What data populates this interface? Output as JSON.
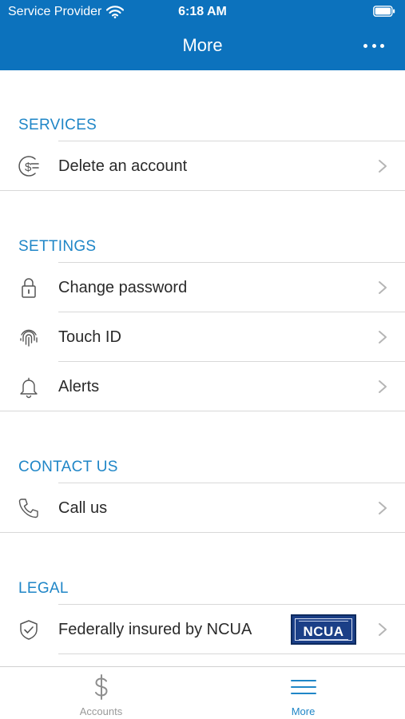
{
  "status_bar": {
    "carrier": "Service Provider",
    "time": "6:18 AM"
  },
  "header": {
    "title": "More"
  },
  "sections": {
    "services": {
      "title": "SERVICES",
      "items": [
        {
          "label": "Delete an account",
          "icon": "dollar-circle-icon"
        }
      ]
    },
    "settings": {
      "title": "SETTINGS",
      "items": [
        {
          "label": "Change password",
          "icon": "lock-icon"
        },
        {
          "label": "Touch ID",
          "icon": "fingerprint-icon"
        },
        {
          "label": "Alerts",
          "icon": "bell-icon"
        }
      ]
    },
    "contact": {
      "title": "CONTACT US",
      "items": [
        {
          "label": "Call us",
          "icon": "phone-icon"
        }
      ]
    },
    "legal": {
      "title": "LEGAL",
      "items": [
        {
          "label": "Federally insured by NCUA",
          "icon": "shield-check-icon",
          "logo_text": "NCUA"
        }
      ]
    }
  },
  "tabbar": {
    "tabs": [
      {
        "label": "Accounts",
        "icon": "dollar-icon",
        "active": false
      },
      {
        "label": "More",
        "icon": "hamburger-menu-icon",
        "active": true
      }
    ]
  },
  "colors": {
    "header_bg": "#0c72bd",
    "accent": "#1f86c7",
    "logo_bg": "#1b3f87"
  }
}
